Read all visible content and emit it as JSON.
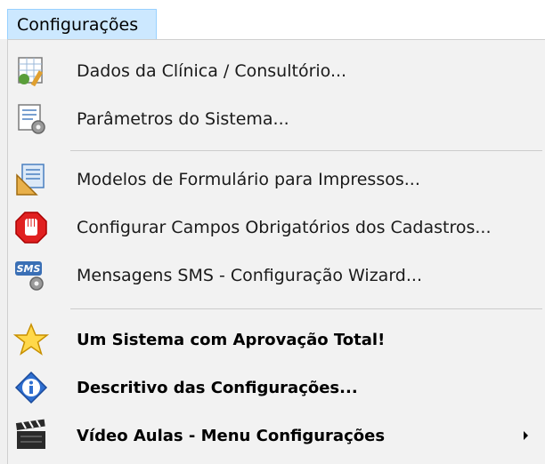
{
  "menubar": {
    "title": "Configurações"
  },
  "menu": {
    "items": [
      {
        "label": "Dados da Clínica / Consultório...",
        "icon": "clinic-data-icon"
      },
      {
        "label": "Parâmetros do Sistema...",
        "icon": "system-parameters-icon"
      },
      {
        "label": "Modelos de Formulário para Impressos...",
        "icon": "form-models-icon"
      },
      {
        "label": "Configurar Campos Obrigatórios dos Cadastros...",
        "icon": "stop-hand-icon"
      },
      {
        "label": "Mensagens SMS - Configuração Wizard...",
        "icon": "sms-gear-icon"
      },
      {
        "label": "Um Sistema com Aprovação Total!",
        "icon": "star-icon"
      },
      {
        "label": "Descritivo das Configurações...",
        "icon": "info-icon"
      },
      {
        "label": "Vídeo Aulas - Menu Configurações",
        "icon": "clapperboard-icon",
        "has_submenu": true
      }
    ]
  },
  "colors": {
    "menubar_highlight": "#cce8ff",
    "menu_background": "#f2f2f2",
    "separator": "#cccccc"
  }
}
